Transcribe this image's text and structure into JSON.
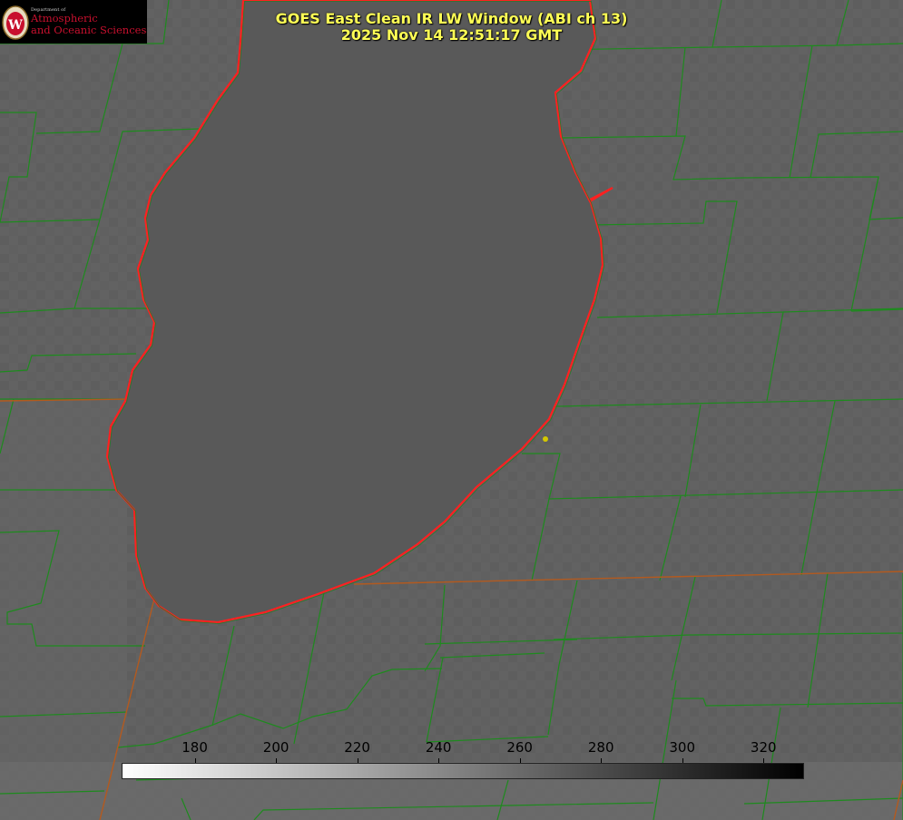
{
  "title": {
    "line1": "GOES East Clean IR LW Window (ABI ch 13)",
    "line2": "2025 Nov 14 12:51:17 GMT"
  },
  "logo": {
    "department": "Department of",
    "line1": "Atmospheric",
    "line2": "and Oceanic Sciences",
    "seal_letter": "W"
  },
  "colorbar": {
    "tick_labels": [
      "180",
      "200",
      "220",
      "240",
      "260",
      "280",
      "300",
      "320"
    ],
    "ticks": [
      180,
      200,
      220,
      240,
      260,
      280,
      300,
      320
    ],
    "range": [
      162,
      330
    ],
    "gradient": [
      "#ffffff",
      "#000000"
    ]
  },
  "colors": {
    "background": "#5f5f5f",
    "lake": "#585858",
    "county_lines": "#1e8a1e",
    "coastline": "#ff2020",
    "title_text": "#ffff55",
    "marker": "#d4c800"
  }
}
